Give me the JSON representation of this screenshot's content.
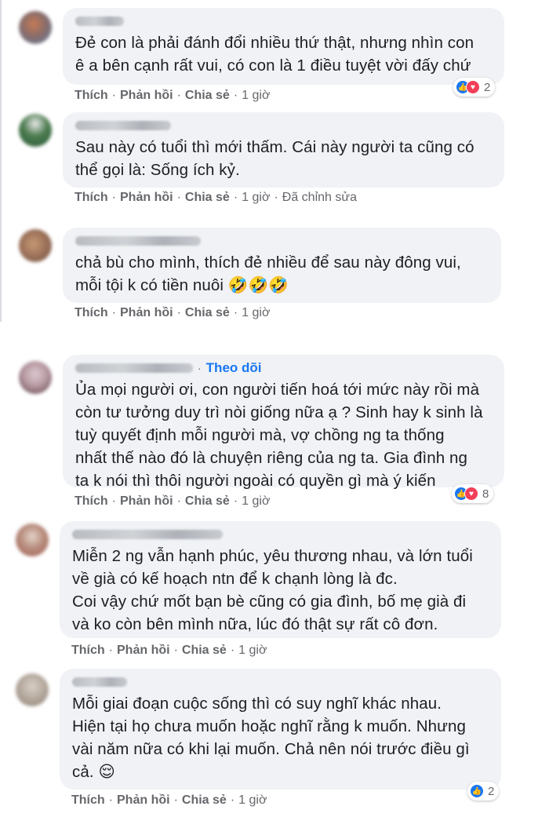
{
  "colors": {
    "bubble": "#f0f2f5",
    "link": "#1877f2",
    "meta": "#65676b",
    "like": "#1877f2",
    "love": "#f33e58"
  },
  "comments": [
    {
      "text": "Đẻ con là phải đánh đổi nhiều thứ thật, nhưng nhìn con\nê a bên cạnh rất vui, có con là 1 điều tuyệt vời đấy chứ",
      "actions": {
        "like": "Thích",
        "reply": "Phản hồi",
        "share": "Chia sẻ",
        "time": "1 giờ"
      },
      "reactions": {
        "icons": [
          "like-icon",
          "love-icon"
        ],
        "count": "2"
      }
    },
    {
      "text": "Sau này có tuổi thì mới thấm. Cái này người ta cũng có\nthể gọi là: Sống ích kỷ.",
      "actions": {
        "like": "Thích",
        "reply": "Phản hồi",
        "share": "Chia sẻ",
        "time": "1 giờ",
        "edited": "Đã chỉnh sửa"
      }
    },
    {
      "text": "chả bù cho mình, thích đẻ nhiều để sau này đông vui,\nmỗi tội k có tiền nuôi 🤣🤣🤣",
      "actions": {
        "like": "Thích",
        "reply": "Phản hồi",
        "share": "Chia sẻ",
        "time": "1 giờ"
      }
    },
    {
      "follow": "Theo dõi",
      "text": "Ủa mọi người ơi, con người tiến hoá tới mức này rồi mà\ncòn tư tưởng duy trì nòi giống nữa ạ ? Sinh hay k sinh là\ntuỳ quyết định mỗi người mà, vợ chồng ng ta thống\nnhất thế nào đó là chuyện riêng của ng ta. Gia đình ng\nta k nói thì thôi người ngoài có quyền gì mà ý kiến",
      "actions": {
        "like": "Thích",
        "reply": "Phản hồi",
        "share": "Chia sẻ",
        "time": "1 giờ"
      },
      "reactions": {
        "icons": [
          "like-icon",
          "love-icon"
        ],
        "count": "8"
      }
    },
    {
      "text": "Miễn 2 ng vẫn hạnh phúc, yêu thương nhau, và lớn tuổi\nvề già có kế hoạch ntn để k chạnh lòng là đc.\nCoi vậy chứ mốt bạn bè cũng có gia đình, bố mẹ già đi\nvà ko còn bên mình nữa, lúc đó thật sự rất cô đơn.",
      "actions": {
        "like": "Thích",
        "reply": "Phản hồi",
        "share": "Chia sẻ",
        "time": "1 giờ"
      }
    },
    {
      "text": "Mỗi giai đoạn cuộc sống thì có suy nghĩ khác nhau.\nHiện tại họ chưa muốn hoặc nghĩ rằng k muốn. Nhưng\nvài năm nữa có khi lại muốn. Chả nên nói trước điều gì\ncả. 😌",
      "actions": {
        "like": "Thích",
        "reply": "Phản hồi",
        "share": "Chia sẻ",
        "time": "1 giờ"
      },
      "reactions": {
        "icons": [
          "like-icon"
        ],
        "count": "2"
      }
    }
  ]
}
